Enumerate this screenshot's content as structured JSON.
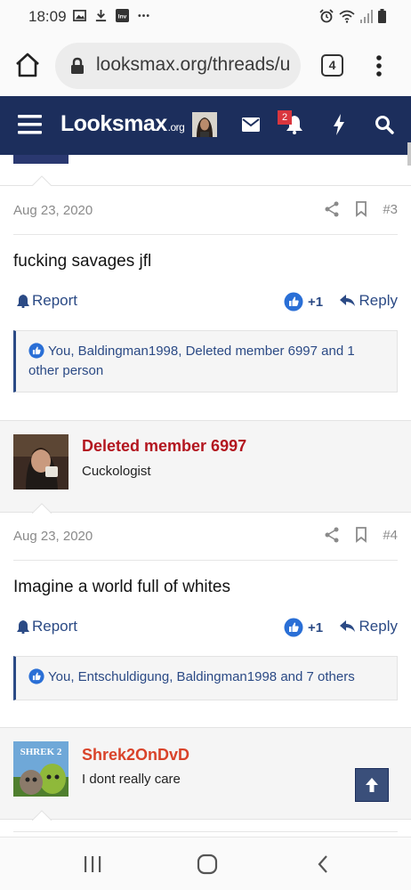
{
  "status_bar": {
    "time": "18:09",
    "tabs_count": "4"
  },
  "browser": {
    "url": "looksmax.org/threads/u"
  },
  "site_header": {
    "logo_main": "Looksmax",
    "logo_suffix": ".org",
    "notification_count": "2"
  },
  "posts": [
    {
      "date": "Aug 23, 2020",
      "number": "#3",
      "body": "fucking savages jfl",
      "report_label": "Report",
      "reaction_count": "+1",
      "reply_label": "Reply",
      "reactions_text": "You, Baldingman1998, Deleted member 6997 and 1 other person"
    },
    {
      "username": "Deleted member 6997",
      "user_title": "Cuckologist",
      "date": "Aug 23, 2020",
      "number": "#4",
      "body": "Imagine a world full of whites",
      "report_label": "Report",
      "reaction_count": "+1",
      "reply_label": "Reply",
      "reactions_text": "You, Entschuldigung, Baldingman1998 and 7 others"
    },
    {
      "username": "Shrek2OnDvD",
      "user_title": "I dont really care",
      "avatar_caption": "SHREK 2"
    }
  ],
  "colors": {
    "header_bg": "#1c2e5c",
    "link": "#2b4a85",
    "deleted_member_name": "#b3161f",
    "member_name": "#d9432a",
    "badge": "#d9363e"
  },
  "icons": [
    "home-icon",
    "lock-icon",
    "menu-icon",
    "mail-icon",
    "bell-icon",
    "bolt-icon",
    "search-icon",
    "share-icon",
    "bookmark-icon",
    "like-icon",
    "reply-icon",
    "arrow-up-icon",
    "recent-apps-icon",
    "home-nav-icon",
    "back-icon"
  ]
}
